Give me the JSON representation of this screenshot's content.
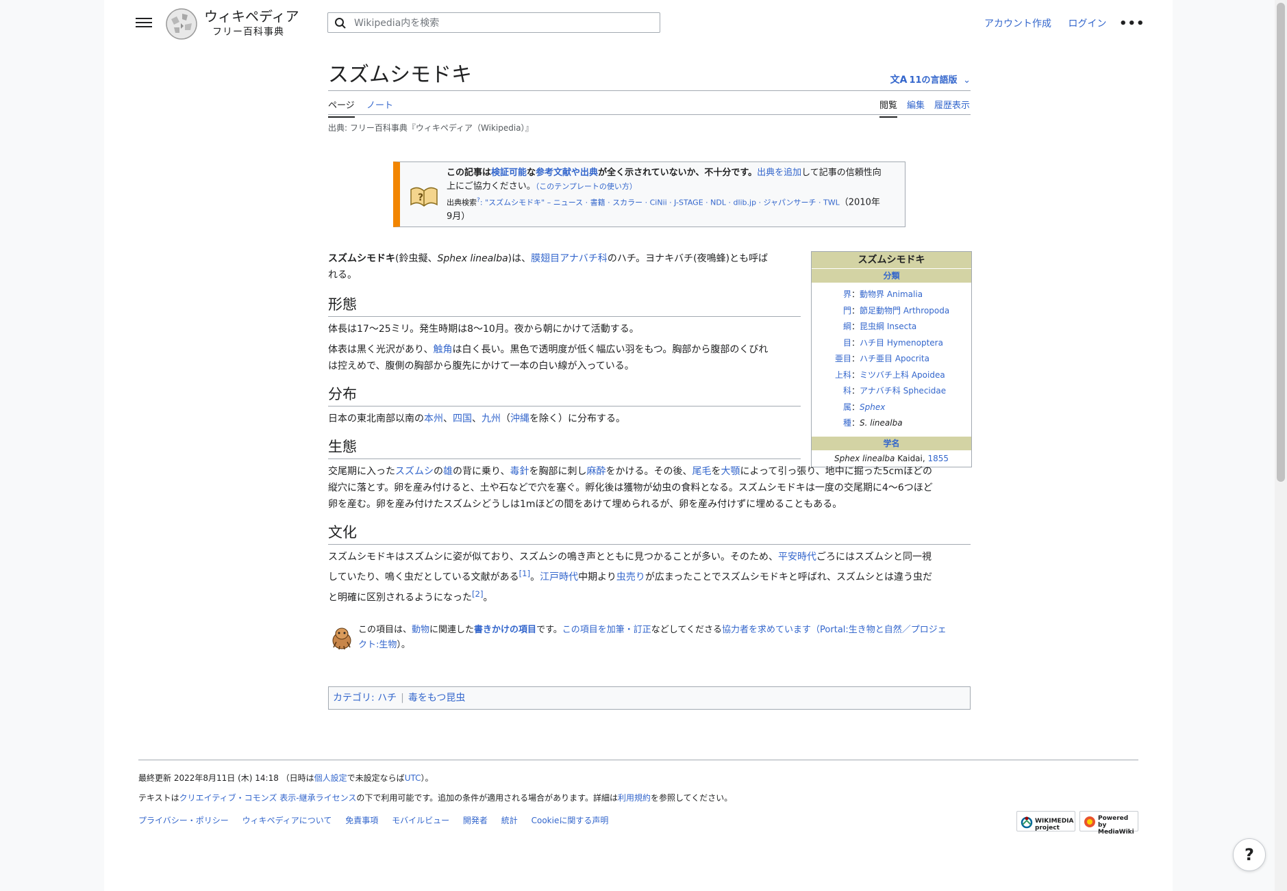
{
  "header": {
    "wordmark": "ウィキペディア",
    "tagline": "フリー百科事典",
    "search_placeholder": "Wikipedia内を検索",
    "create_account": "アカウント作成",
    "login": "ログイン",
    "more": "•••"
  },
  "article": {
    "title": "スズムシモドキ",
    "languages": "11の言語版",
    "tabs": {
      "page": "ページ",
      "talk": "ノート",
      "read": "閲覧",
      "edit": "編集",
      "history": "履歴表示"
    },
    "from": "出典: フリー百科事典『ウィキペディア（Wikipedia）』"
  },
  "ambox": {
    "l1_a": "この記事は",
    "l1_b": "検証可能",
    "l1_c": "な",
    "l1_d": "参考文献や出典",
    "l1_e": "が全く示されていないか、不十分です。",
    "l1_f": "出典を追加",
    "l1_g": "して記事の信頼性向",
    "l2_a": "上にご協力ください。",
    "l2_b": "（このテンプレートの使い方）",
    "l3_a": "出典検索",
    "l3_b": "?",
    "l3_c": ": \"スズムシモドキ\" – ニュース · 書籍 · スカラー · CiNii · J-STAGE · NDL · dlib.jp · ジャパンサーチ · TWL",
    "l3_d": "（2010年",
    "l4": "9月）"
  },
  "intro": {
    "bold": "スズムシモドキ",
    "t1": "(鈴虫擬、",
    "italic": "Sphex linealba",
    "t2": ")は、",
    "link1": "膜翅目アナバチ科",
    "t3": "のハチ。ヨナキバチ(夜鳴蜂)とも呼ば",
    "t4": "れる。"
  },
  "sections": {
    "morph_title": "形態",
    "morph_p1": "体長は17〜25ミリ。発生時期は8〜10月。夜から朝にかけて活動する。",
    "morph_p2_a": "体表は黒く光沢があり、",
    "morph_p2_link": "触角",
    "morph_p2_b": "は白く長い。黒色で透明度が低く幅広い羽をもつ。胸部から腹部のくびれ",
    "morph_p2_c": "は控えめで、腹側の胸部から腹先にかけて一本の白い線が入っている。",
    "dist_title": "分布",
    "dist_a": "日本の東北南部以南の",
    "dist_l1": "本州",
    "dist_s1": "、",
    "dist_l2": "四国",
    "dist_s2": "、",
    "dist_l3": "九州",
    "dist_b": "（",
    "dist_l4": "沖縄",
    "dist_c": "を除く）に分布する。",
    "eco_title": "生態",
    "eco_a": "交尾期に入った",
    "eco_l1": "スズムシ",
    "eco_b": "の",
    "eco_l2": "雄",
    "eco_c": "の背に乗り、",
    "eco_l3": "毒針",
    "eco_d": "を胸部に刺し",
    "eco_l4": "麻酔",
    "eco_e": "をかける。その後、",
    "eco_l5": "尾毛",
    "eco_f": "を",
    "eco_l6": "大顎",
    "eco_g": "によって引っ張り、地中に掘った5cmほどの",
    "eco_h": "縦穴に落とす。卵を産み付けると、土や石などで穴を塞ぐ。孵化後は獲物が幼虫の食料となる。スズムシモドキは一度の交尾期に4〜6つほど",
    "eco_i": "卵を産む。卵を産み付けたスズムシどうしは1mほどの間をあけて埋められるが、卵を産み付けずに埋めることもある。",
    "cult_title": "文化",
    "cult_a": "スズムシモドキはスズムシに姿が似ており、スズムシの鳴き声とともに見つかることが多い。そのため、",
    "cult_l1": "平安時代",
    "cult_b": "ごろにはスズムシと同一視",
    "cult_c": "していたり、鳴く虫だとしている文献がある",
    "cult_ref1": "[1]",
    "cult_d": "。",
    "cult_l2": "江戸時代",
    "cult_e": "中期より",
    "cult_l3": "虫売り",
    "cult_f": "が広まったことでスズムシモドキと呼ばれ、スズムシとは違う虫だ",
    "cult_g": "と明確に区別されるようになった",
    "cult_ref2": "[2]",
    "cult_h": "。"
  },
  "stub": {
    "a": "この項目は、",
    "l1": "動物",
    "b": "に関連した",
    "l2": "書きかけの項目",
    "c": "です。",
    "l3": "この項目を加筆・訂正",
    "d": "などしてくださる",
    "l4": "協力者を求めています",
    "e": "（",
    "l5": "Portal:生き物と自然",
    "f": "／",
    "l6": "プロジェ",
    "l7": "クト:生物",
    "g": "）。"
  },
  "infobox": {
    "title": "スズムシモドキ",
    "classification": "分類",
    "rows": [
      {
        "rank": "界",
        "name": "動物界 Animalia"
      },
      {
        "rank": "門",
        "name": "節足動物門 Arthropoda"
      },
      {
        "rank": "綱",
        "name": "昆虫綱 Insecta"
      },
      {
        "rank": "目",
        "name": "ハチ目 Hymenoptera"
      },
      {
        "rank": "亜目",
        "name": "ハチ亜目 Apocrita"
      },
      {
        "rank": "上科",
        "name": "ミツバチ上科 Apoidea"
      },
      {
        "rank": "科",
        "name": "アナバチ科 Sphecidae"
      },
      {
        "rank": "属",
        "name": "Sphex"
      },
      {
        "rank": "種",
        "name": "S. linealba"
      }
    ],
    "sci_header": "学名",
    "sci_name": "Sphex linealba",
    "sci_author": " Kaidai, ",
    "sci_year": "1855"
  },
  "categories": {
    "label": "カテゴリ",
    "colon": ": ",
    "c1": "ハチ",
    "c2": "毒をもつ昆虫"
  },
  "footer": {
    "last_mod_a": "最終更新 2022年8月11日 (木) 14:18 （日時は",
    "last_mod_l1": "個人設定",
    "last_mod_b": "で未設定ならば",
    "last_mod_l2": "UTC",
    "last_mod_c": "）。",
    "license_a": "テキストは",
    "license_l1": "クリエイティブ・コモンズ 表示-継承ライセンス",
    "license_b": "の下で利用可能です。追加の条件が適用される場合があります。詳細は",
    "license_l2": "利用規約",
    "license_c": "を参照してください。",
    "links": [
      "プライバシー・ポリシー",
      "ウィキペディアについて",
      "免責事項",
      "モバイルビュー",
      "開発者",
      "統計",
      "Cookieに関する声明"
    ],
    "wikimedia_badge": "WIKIMEDIA project",
    "mediawiki_badge": "Powered by MediaWiki"
  },
  "help_label": "?"
}
